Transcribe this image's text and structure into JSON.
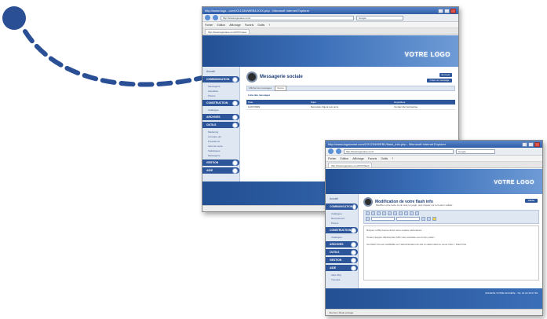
{
  "colors": {
    "accent": "#2d559a",
    "dot": "#2a4f95",
    "banner": "#3b6fb8"
  },
  "window1": {
    "title": "http://www.logo...com/XX1234/WEB1/XXX.php - Microsoft Internet Explorer",
    "address": "http://www.logoname.com/",
    "search_placeholder": "Google",
    "menu": [
      "Fichier",
      "Edition",
      "Affichage",
      "Favoris",
      "Outils",
      "?"
    ],
    "tab": "http://www.logoname.com/XXX/mess",
    "logo": "VOTRE LOGO",
    "sidebar": {
      "home": "Accueil",
      "items": [
        "COMMUNICATION",
        "CONSTRUCTION",
        "ARCHIVES",
        "OUTILS",
        "GESTION",
        "AIDE"
      ],
      "subs_a": [
        "Messagerie",
        "Actualités",
        "Photos"
      ],
      "subs_b": [
        "Catalogue"
      ],
      "subs_c": [
        "Marketing",
        "Annuaire pro",
        "Prestations",
        "Suivi de vente",
        "Statistiques",
        "Messagerie"
      ]
    },
    "content": {
      "title": "Messagerie sociale",
      "send_button": "Envoyer",
      "new_button": "Créer un message",
      "filter_label": "Afficher les messages",
      "filter_value": "Reçus",
      "list_title": "Liste des messages",
      "columns": [
        "Date",
        "Sujet",
        "Expéditeur"
      ],
      "rows": [
        [
          "12/07/2009",
          "Demande d'ajout aux amis",
          "Contact de l'entreprise"
        ]
      ]
    },
    "status": ""
  },
  "window2": {
    "title": "http://www.logoname.com/XX1234/WEB1/flash_info.php - Microsoft Internet Explorer",
    "address": "http://www.logoname.com/",
    "search_placeholder": "Google",
    "menu": [
      "Fichier",
      "Edition",
      "Affichage",
      "Favoris",
      "Outils",
      "?"
    ],
    "tab": "http://www.logoname.com/XXX/flash",
    "logo": "VOTRE LOGO",
    "sidebar": {
      "home": "Accueil",
      "items": [
        "COMMUNICATION",
        "CONSTRUCTION",
        "ARCHIVES",
        "OUTILS",
        "GESTION",
        "AIDE"
      ],
      "subs_a": [
        "Catalogue",
        "Recrutement"
      ],
      "subs_b": [
        "Photos"
      ],
      "subs_c": [
        "Catalogue"
      ],
      "subs_d": [
        "Aide FAQ",
        "Tutoriels"
      ]
    },
    "content": {
      "title": "Modification de votre flash info",
      "subtitle": "Modifiez votre texte et sa mise en page, puis cliquez sur le bouton valider.",
      "validate_button": "Valider",
      "editor_lines": [
        "Bonjour et Bienvenue dans notre espace partenaires.",
        "Toutes l'équipe d'Entreprise SAS vous souhaite une bonne visite !",
        "Cet flash info est modifiable sur l'administration du site en allant dans le menu Infos > Flash Info"
      ]
    },
    "footer_text": "SOCIETE VOTRE SOCIETE - Tél. 01 23 45 67 89",
    "status": "Internet | Mode protégé"
  }
}
